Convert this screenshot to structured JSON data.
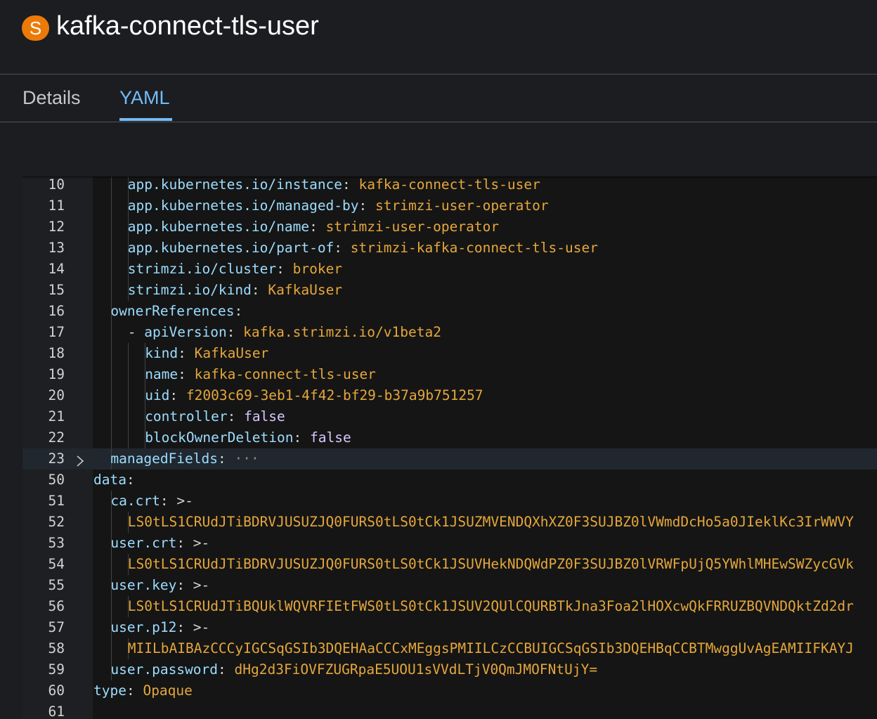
{
  "header": {
    "badge": "S",
    "title": "kafka-connect-tls-user"
  },
  "tabs": [
    {
      "label": "Details",
      "active": false
    },
    {
      "label": "YAML",
      "active": true
    }
  ],
  "colors": {
    "badge": "#ec7a08",
    "active_tab": "#73bcf7",
    "yaml_key": "#9cdcfe",
    "yaml_value": "#e5a73b",
    "yaml_boolean": "#d9c6ff"
  },
  "editor": {
    "fold_icon": "chevron-right-icon",
    "lines": [
      {
        "num": "10",
        "indent": 2,
        "key": "app.kubernetes.io/instance",
        "sep": ": ",
        "value": "kafka-connect-tls-user",
        "vtype": "string"
      },
      {
        "num": "11",
        "indent": 2,
        "key": "app.kubernetes.io/managed-by",
        "sep": ": ",
        "value": "strimzi-user-operator",
        "vtype": "string"
      },
      {
        "num": "12",
        "indent": 2,
        "key": "app.kubernetes.io/name",
        "sep": ": ",
        "value": "strimzi-user-operator",
        "vtype": "string"
      },
      {
        "num": "13",
        "indent": 2,
        "key": "app.kubernetes.io/part-of",
        "sep": ": ",
        "value": "strimzi-kafka-connect-tls-user",
        "vtype": "string"
      },
      {
        "num": "14",
        "indent": 2,
        "key": "strimzi.io/cluster",
        "sep": ": ",
        "value": "broker",
        "vtype": "string"
      },
      {
        "num": "15",
        "indent": 2,
        "key": "strimzi.io/kind",
        "sep": ": ",
        "value": "KafkaUser",
        "vtype": "string"
      },
      {
        "num": "16",
        "indent": 1,
        "key": "ownerReferences",
        "sep": ":",
        "value": "",
        "vtype": "string"
      },
      {
        "num": "17",
        "indent": 2,
        "dash": "- ",
        "key": "apiVersion",
        "sep": ": ",
        "value": "kafka.strimzi.io/v1beta2",
        "vtype": "string"
      },
      {
        "num": "18",
        "indent": 3,
        "key": "kind",
        "sep": ": ",
        "value": "KafkaUser",
        "vtype": "string"
      },
      {
        "num": "19",
        "indent": 3,
        "key": "name",
        "sep": ": ",
        "value": "kafka-connect-tls-user",
        "vtype": "string"
      },
      {
        "num": "20",
        "indent": 3,
        "key": "uid",
        "sep": ": ",
        "value": "f2003c69-3eb1-4f42-bf29-b37a9b751257",
        "vtype": "string"
      },
      {
        "num": "21",
        "indent": 3,
        "key": "controller",
        "sep": ": ",
        "value": "false",
        "vtype": "bool"
      },
      {
        "num": "22",
        "indent": 3,
        "key": "blockOwnerDeletion",
        "sep": ": ",
        "value": "false",
        "vtype": "bool"
      },
      {
        "num": "23",
        "indent": 1,
        "key": "managedFields",
        "sep": ":",
        "value": " ···",
        "vtype": "ellipsis",
        "folded": true,
        "highlight": true
      },
      {
        "num": "50",
        "indent": 0,
        "key": "data",
        "sep": ":",
        "value": "",
        "vtype": "string"
      },
      {
        "num": "51",
        "indent": 1,
        "key": "ca.crt",
        "sep": ": ",
        "value": ">-",
        "vtype": "plain"
      },
      {
        "num": "52",
        "indent": 2,
        "key": "",
        "sep": "",
        "value": "LS0tLS1CRUdJTiBDRVJUSUZJQ0FURS0tLS0tCk1JSUZMVENDQXhXZ0F3SUJBZ0lVWmdDcHo5a0JIeklKc3IrWWVY",
        "vtype": "string"
      },
      {
        "num": "53",
        "indent": 1,
        "key": "user.crt",
        "sep": ": ",
        "value": ">-",
        "vtype": "plain"
      },
      {
        "num": "54",
        "indent": 2,
        "key": "",
        "sep": "",
        "value": "LS0tLS1CRUdJTiBDRVJUSUZJQ0FURS0tLS0tCk1JSUVHekNDQWdPZ0F3SUJBZ0lVRWFpUjQ5YWhlMHEwSWZycGVk",
        "vtype": "string"
      },
      {
        "num": "55",
        "indent": 1,
        "key": "user.key",
        "sep": ": ",
        "value": ">-",
        "vtype": "plain"
      },
      {
        "num": "56",
        "indent": 2,
        "key": "",
        "sep": "",
        "value": "LS0tLS1CRUdJTiBQUklWQVRFIEtFWS0tLS0tCk1JSUV2QUlCQURBTkJna3Foa2lHOXcwQkFRRUZBQVNDQktZd2dr",
        "vtype": "string"
      },
      {
        "num": "57",
        "indent": 1,
        "key": "user.p12",
        "sep": ": ",
        "value": ">-",
        "vtype": "plain"
      },
      {
        "num": "58",
        "indent": 2,
        "key": "",
        "sep": "",
        "value": "MIILbAIBAzCCCyIGCSqGSIb3DQEHAaCCCxMEggsPMIILCzCCBUIGCSqGSIb3DQEHBqCCBTMwggUvAgEAMIIFKAYJ",
        "vtype": "string"
      },
      {
        "num": "59",
        "indent": 1,
        "key": "user.password",
        "sep": ": ",
        "value": "dHg2d3FiOVFZUGRpaE5UOU1sVVdLTjV0QmJMOFNtUjY=",
        "vtype": "string"
      },
      {
        "num": "60",
        "indent": 0,
        "key": "type",
        "sep": ": ",
        "value": "Opaque",
        "vtype": "string"
      },
      {
        "num": "61",
        "indent": 0,
        "key": "",
        "sep": "",
        "value": "",
        "vtype": "string"
      }
    ]
  }
}
